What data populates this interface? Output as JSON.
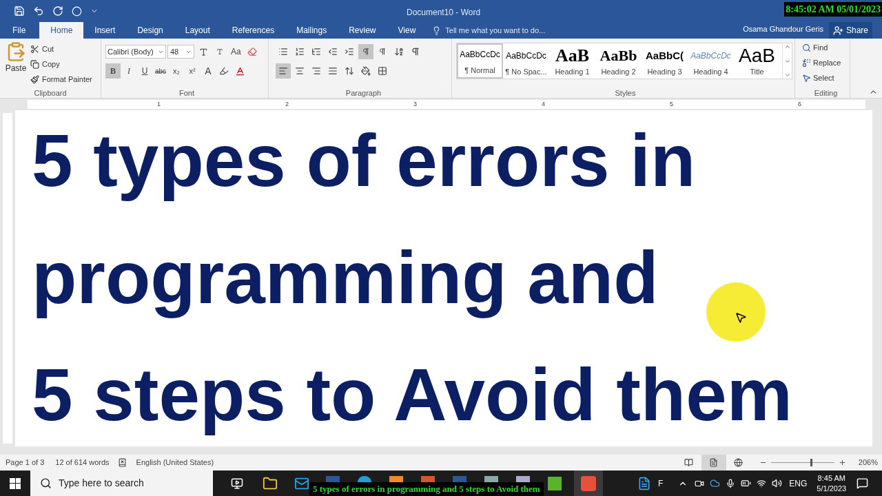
{
  "title_bar": {
    "title": "Document10 - Word"
  },
  "tabs": [
    {
      "label": "File",
      "selected": false,
      "kind": "file"
    },
    {
      "label": "Home",
      "selected": true,
      "kind": "tab"
    },
    {
      "label": "Insert",
      "selected": false,
      "kind": "tab"
    },
    {
      "label": "Design",
      "selected": false,
      "kind": "tab"
    },
    {
      "label": "Layout",
      "selected": false,
      "kind": "tab"
    },
    {
      "label": "References",
      "selected": false,
      "kind": "tab"
    },
    {
      "label": "Mailings",
      "selected": false,
      "kind": "tab"
    },
    {
      "label": "Review",
      "selected": false,
      "kind": "tab"
    },
    {
      "label": "View",
      "selected": false,
      "kind": "tab"
    }
  ],
  "tell_me": {
    "placeholder": "Tell me what you want to do..."
  },
  "user": "Osama Ghandour Geris",
  "share": "Share",
  "clipboard": {
    "label": "Clipboard",
    "paste": "Paste",
    "items": [
      "Cut",
      "Copy",
      "Format Painter"
    ]
  },
  "font": {
    "label": "Font",
    "family": "Calibri (Body)",
    "size": "48",
    "case_button": "Aa",
    "buttons": [
      {
        "label": "B",
        "kind": "bold",
        "selected": true
      },
      {
        "label": "I",
        "kind": "italic",
        "selected": false
      },
      {
        "label": "U",
        "kind": "underline",
        "selected": false
      },
      {
        "label": "abc",
        "kind": "strike",
        "selected": false
      },
      {
        "label": "x₂",
        "kind": "sub",
        "selected": false
      },
      {
        "label": "x²",
        "kind": "sup",
        "selected": false
      },
      {
        "label": "A",
        "kind": "effects",
        "selected": false
      }
    ]
  },
  "paragraph": {
    "label": "Paragraph",
    "align_left": true,
    "ltr": true
  },
  "styles": {
    "label": "Styles",
    "items": [
      {
        "preview": "AaBbCcDc",
        "name": "¶ Normal",
        "selected": true,
        "kind": "normal"
      },
      {
        "preview": "AaBbCcDc",
        "name": "¶ No Spac...",
        "selected": false,
        "kind": "normal"
      },
      {
        "preview": "AaB",
        "name": "Heading 1",
        "selected": false,
        "kind": "h1"
      },
      {
        "preview": "AaBb",
        "name": "Heading 2",
        "selected": false,
        "kind": "h2"
      },
      {
        "preview": "AaBbC(",
        "name": "Heading 3",
        "selected": false,
        "kind": "h3"
      },
      {
        "preview": "AaBbCcDc",
        "name": "Heading 4",
        "selected": false,
        "kind": "h4"
      },
      {
        "preview": "AaB",
        "name": "Title",
        "selected": false,
        "kind": "title"
      }
    ]
  },
  "editing": {
    "label": "Editing",
    "items": [
      {
        "label": "Find",
        "kind": "find"
      },
      {
        "label": "Replace",
        "kind": "replace"
      },
      {
        "label": "Select",
        "kind": "select"
      }
    ]
  },
  "ruler": [
    "1",
    "2",
    "3",
    "4",
    "5",
    "6"
  ],
  "document": {
    "lines": [
      "5 types of errors in",
      "programming and",
      "5 steps to Avoid them"
    ]
  },
  "status_bar": {
    "page": "Page 1 of 3",
    "words": "12 of 614 words",
    "language": "English (United States)",
    "views": [
      {
        "kind": "read",
        "selected": false
      },
      {
        "kind": "print",
        "selected": true
      },
      {
        "kind": "web",
        "selected": false
      }
    ],
    "zoom_slider": {
      "level": 0.62
    },
    "zoom": "206%"
  },
  "taskbar": {
    "search": {
      "placeholder": "Type here to search"
    },
    "tray_letter": "F",
    "language": "ENG",
    "time": "8:45 AM",
    "date": "5/1/2023"
  },
  "overlays": {
    "clock": "8:45:02 AM 05/01/2023",
    "caption": "5 types of errors in programming and 5 steps to Avoid them"
  }
}
